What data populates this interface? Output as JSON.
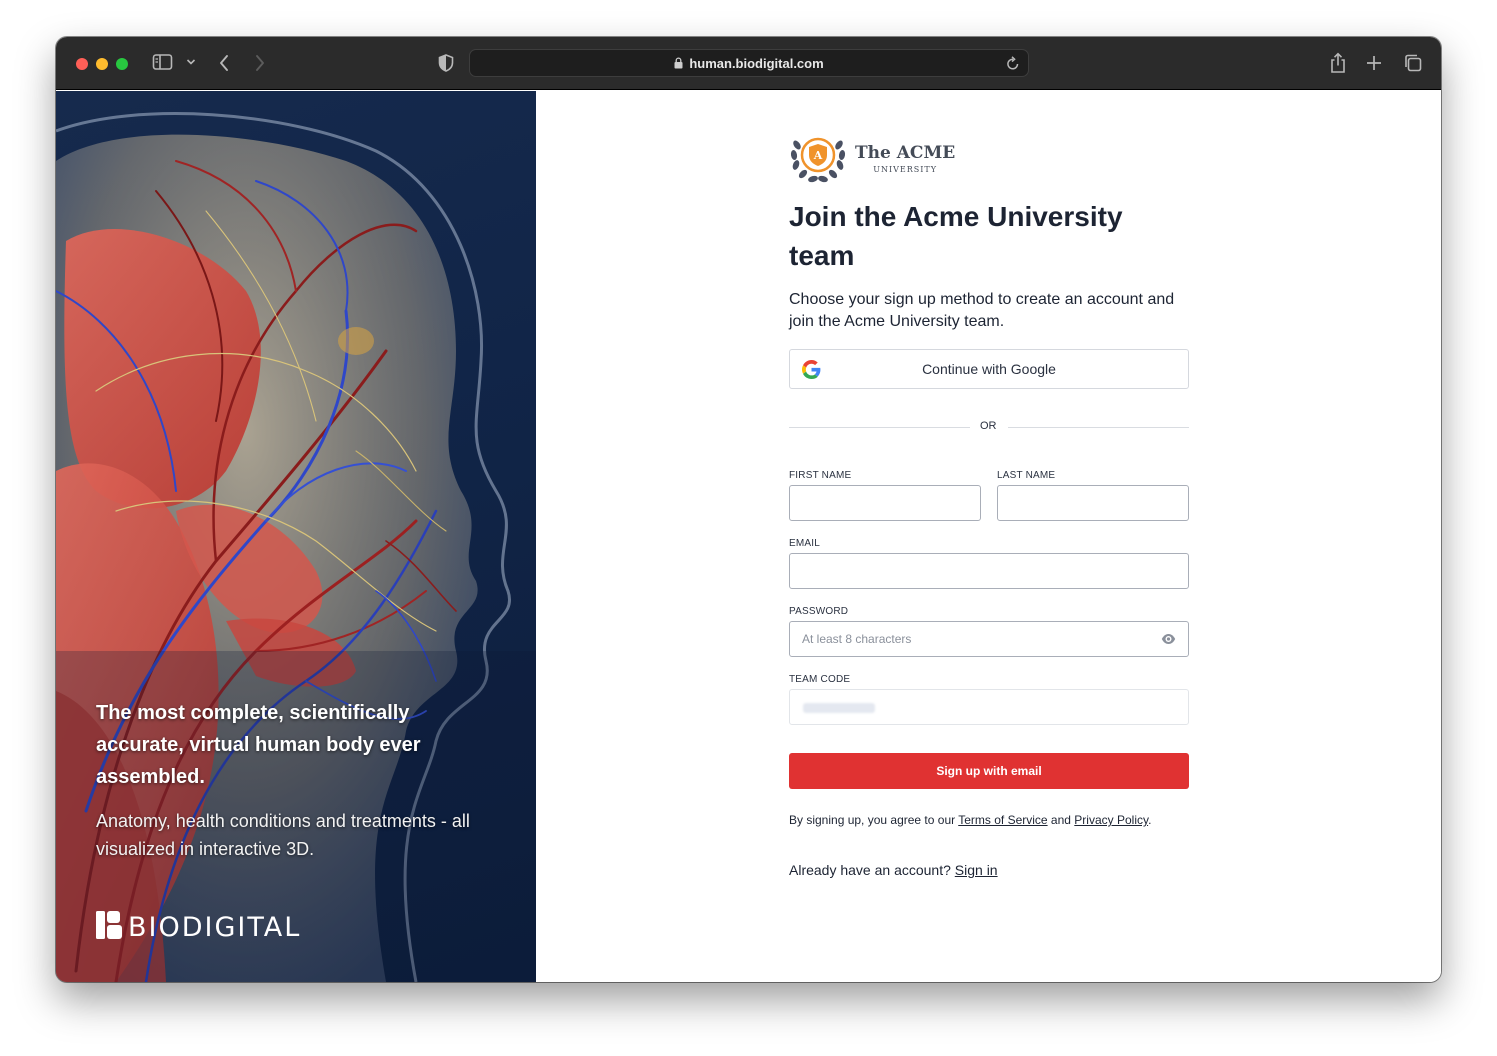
{
  "browser": {
    "url": "human.biodigital.com"
  },
  "hero": {
    "headline": "The most complete, scientifically accurate, virtual human body ever assembled.",
    "subtext": "Anatomy, health conditions and treatments - all visualized in interactive 3D.",
    "brand": "BIODIGITAL"
  },
  "logo": {
    "name": "The ACME",
    "tagline": "UNIVERSITY",
    "badge_letter": "A"
  },
  "form": {
    "title": "Join the Acme University team",
    "subtitle": "Choose your sign up method to create an account and join the Acme University team.",
    "google_button": "Continue with Google",
    "divider": "OR",
    "first_name_label": "FIRST NAME",
    "last_name_label": "LAST NAME",
    "email_label": "EMAIL",
    "password_label": "PASSWORD",
    "password_placeholder": "At least 8 characters",
    "team_code_label": "TEAM CODE",
    "submit_button": "Sign up with email",
    "terms_prefix": "By signing up, you agree to our ",
    "terms_link": "Terms of Service",
    "terms_and": " and ",
    "privacy_link": "Privacy Policy",
    "terms_suffix": ".",
    "signin_prompt": "Already have an account? ",
    "signin_link": "Sign in"
  },
  "colors": {
    "accent_red": "#e03232",
    "hero_bg": "#112548",
    "titlebar": "#2b2b2b",
    "logo_orange": "#f0932b"
  },
  "icons": [
    "sidebar-icon",
    "chevron-down-icon",
    "back-icon",
    "forward-icon",
    "shield-icon",
    "lock-icon",
    "reload-icon",
    "share-icon",
    "plus-icon",
    "tabs-icon",
    "google-icon",
    "eye-icon",
    "biodigital-logo-icon"
  ]
}
